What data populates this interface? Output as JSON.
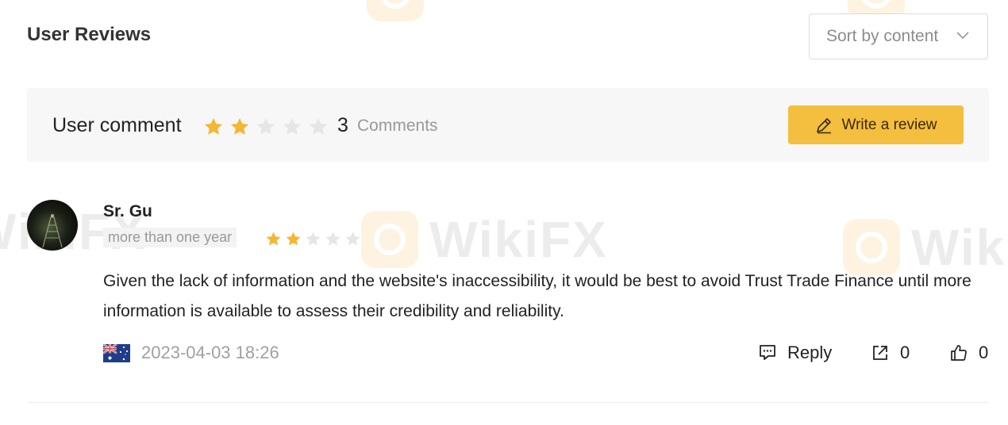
{
  "header": {
    "title": "User Reviews",
    "sort_label": "Sort by content"
  },
  "summary": {
    "label": "User comment",
    "rating": 2,
    "max_rating": 5,
    "count": "3",
    "count_label": "Comments",
    "write_button": "Write a review"
  },
  "review": {
    "user": "Sr. Gu",
    "tenure": "more than one year",
    "rating": 2,
    "text": "Given the lack of information and the website's inaccessibility, it would be best to avoid Trust Trade Finance until more information is available to assess their credibility and reliability.",
    "country_flag": "australia-flag",
    "timestamp": "2023-04-03 18:26",
    "reply_label": "Reply",
    "share_count": "0",
    "like_count": "0"
  },
  "watermark": {
    "text": "WikiFX"
  },
  "colors": {
    "star_filled": "#f4b731",
    "star_empty": "#e6e6e6",
    "accent": "#f4be3e"
  },
  "icons": {
    "sort": "chevron-down-icon",
    "write": "pen-icon",
    "reply": "comment-icon",
    "share": "share-icon",
    "like": "thumbs-up-icon"
  }
}
